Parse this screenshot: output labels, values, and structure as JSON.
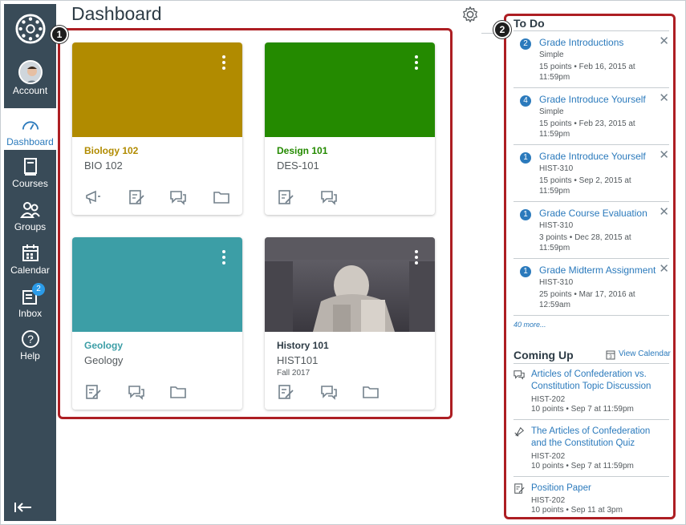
{
  "header": {
    "title": "Dashboard"
  },
  "nav": {
    "account": "Account",
    "dashboard": "Dashboard",
    "courses": "Courses",
    "groups": "Groups",
    "calendar": "Calendar",
    "inbox": "Inbox",
    "inbox_badge": "2",
    "help": "Help"
  },
  "callouts": {
    "one": "1",
    "two": "2"
  },
  "cards": [
    {
      "name": "Biology 102",
      "code": "BIO 102",
      "term": "",
      "color": "#b18b00"
    },
    {
      "name": "Design 101",
      "code": "DES-101",
      "term": "",
      "color": "#248a00"
    },
    {
      "name": "Geology",
      "code": "Geology",
      "term": "",
      "color": "#3c9ea6"
    },
    {
      "name": "History 101",
      "code": "HIST101",
      "term": "Fall 2017",
      "color": "#4d4d53"
    }
  ],
  "todo": {
    "title": "To Do",
    "items": [
      {
        "count": "2",
        "title": "Grade Introductions",
        "course": "Simple",
        "meta": "15 points • Feb 16, 2015 at 11:59pm"
      },
      {
        "count": "4",
        "title": "Grade Introduce Yourself",
        "course": "Simple",
        "meta": "15 points • Feb 23, 2015 at 11:59pm"
      },
      {
        "count": "1",
        "title": "Grade Introduce Yourself",
        "course": "HIST-310",
        "meta": "15 points • Sep 2, 2015 at 11:59pm"
      },
      {
        "count": "1",
        "title": "Grade Course Evaluation",
        "course": "HIST-310",
        "meta": "3 points • Dec 28, 2015 at 11:59pm"
      },
      {
        "count": "1",
        "title": "Grade Midterm Assignment",
        "course": "HIST-310",
        "meta": "25 points • Mar 17, 2016 at 12:59am"
      }
    ],
    "more": "40 more..."
  },
  "coming_up": {
    "title": "Coming Up",
    "view_calendar": "View Calendar",
    "items": [
      {
        "icon": "discussion-icon",
        "title": "Articles of Confederation vs. Constitution Topic Discussion",
        "course": "HIST-202",
        "meta": "10 points • Sep 7 at 11:59pm"
      },
      {
        "icon": "quiz-icon",
        "title": "The Articles of Confederation and the Constitution Quiz",
        "course": "HIST-202",
        "meta": "10 points • Sep 7 at 11:59pm"
      },
      {
        "icon": "assignment-icon",
        "title": "Position Paper",
        "course": "HIST-202",
        "meta": "10 points • Sep 11 at 3pm"
      }
    ]
  }
}
